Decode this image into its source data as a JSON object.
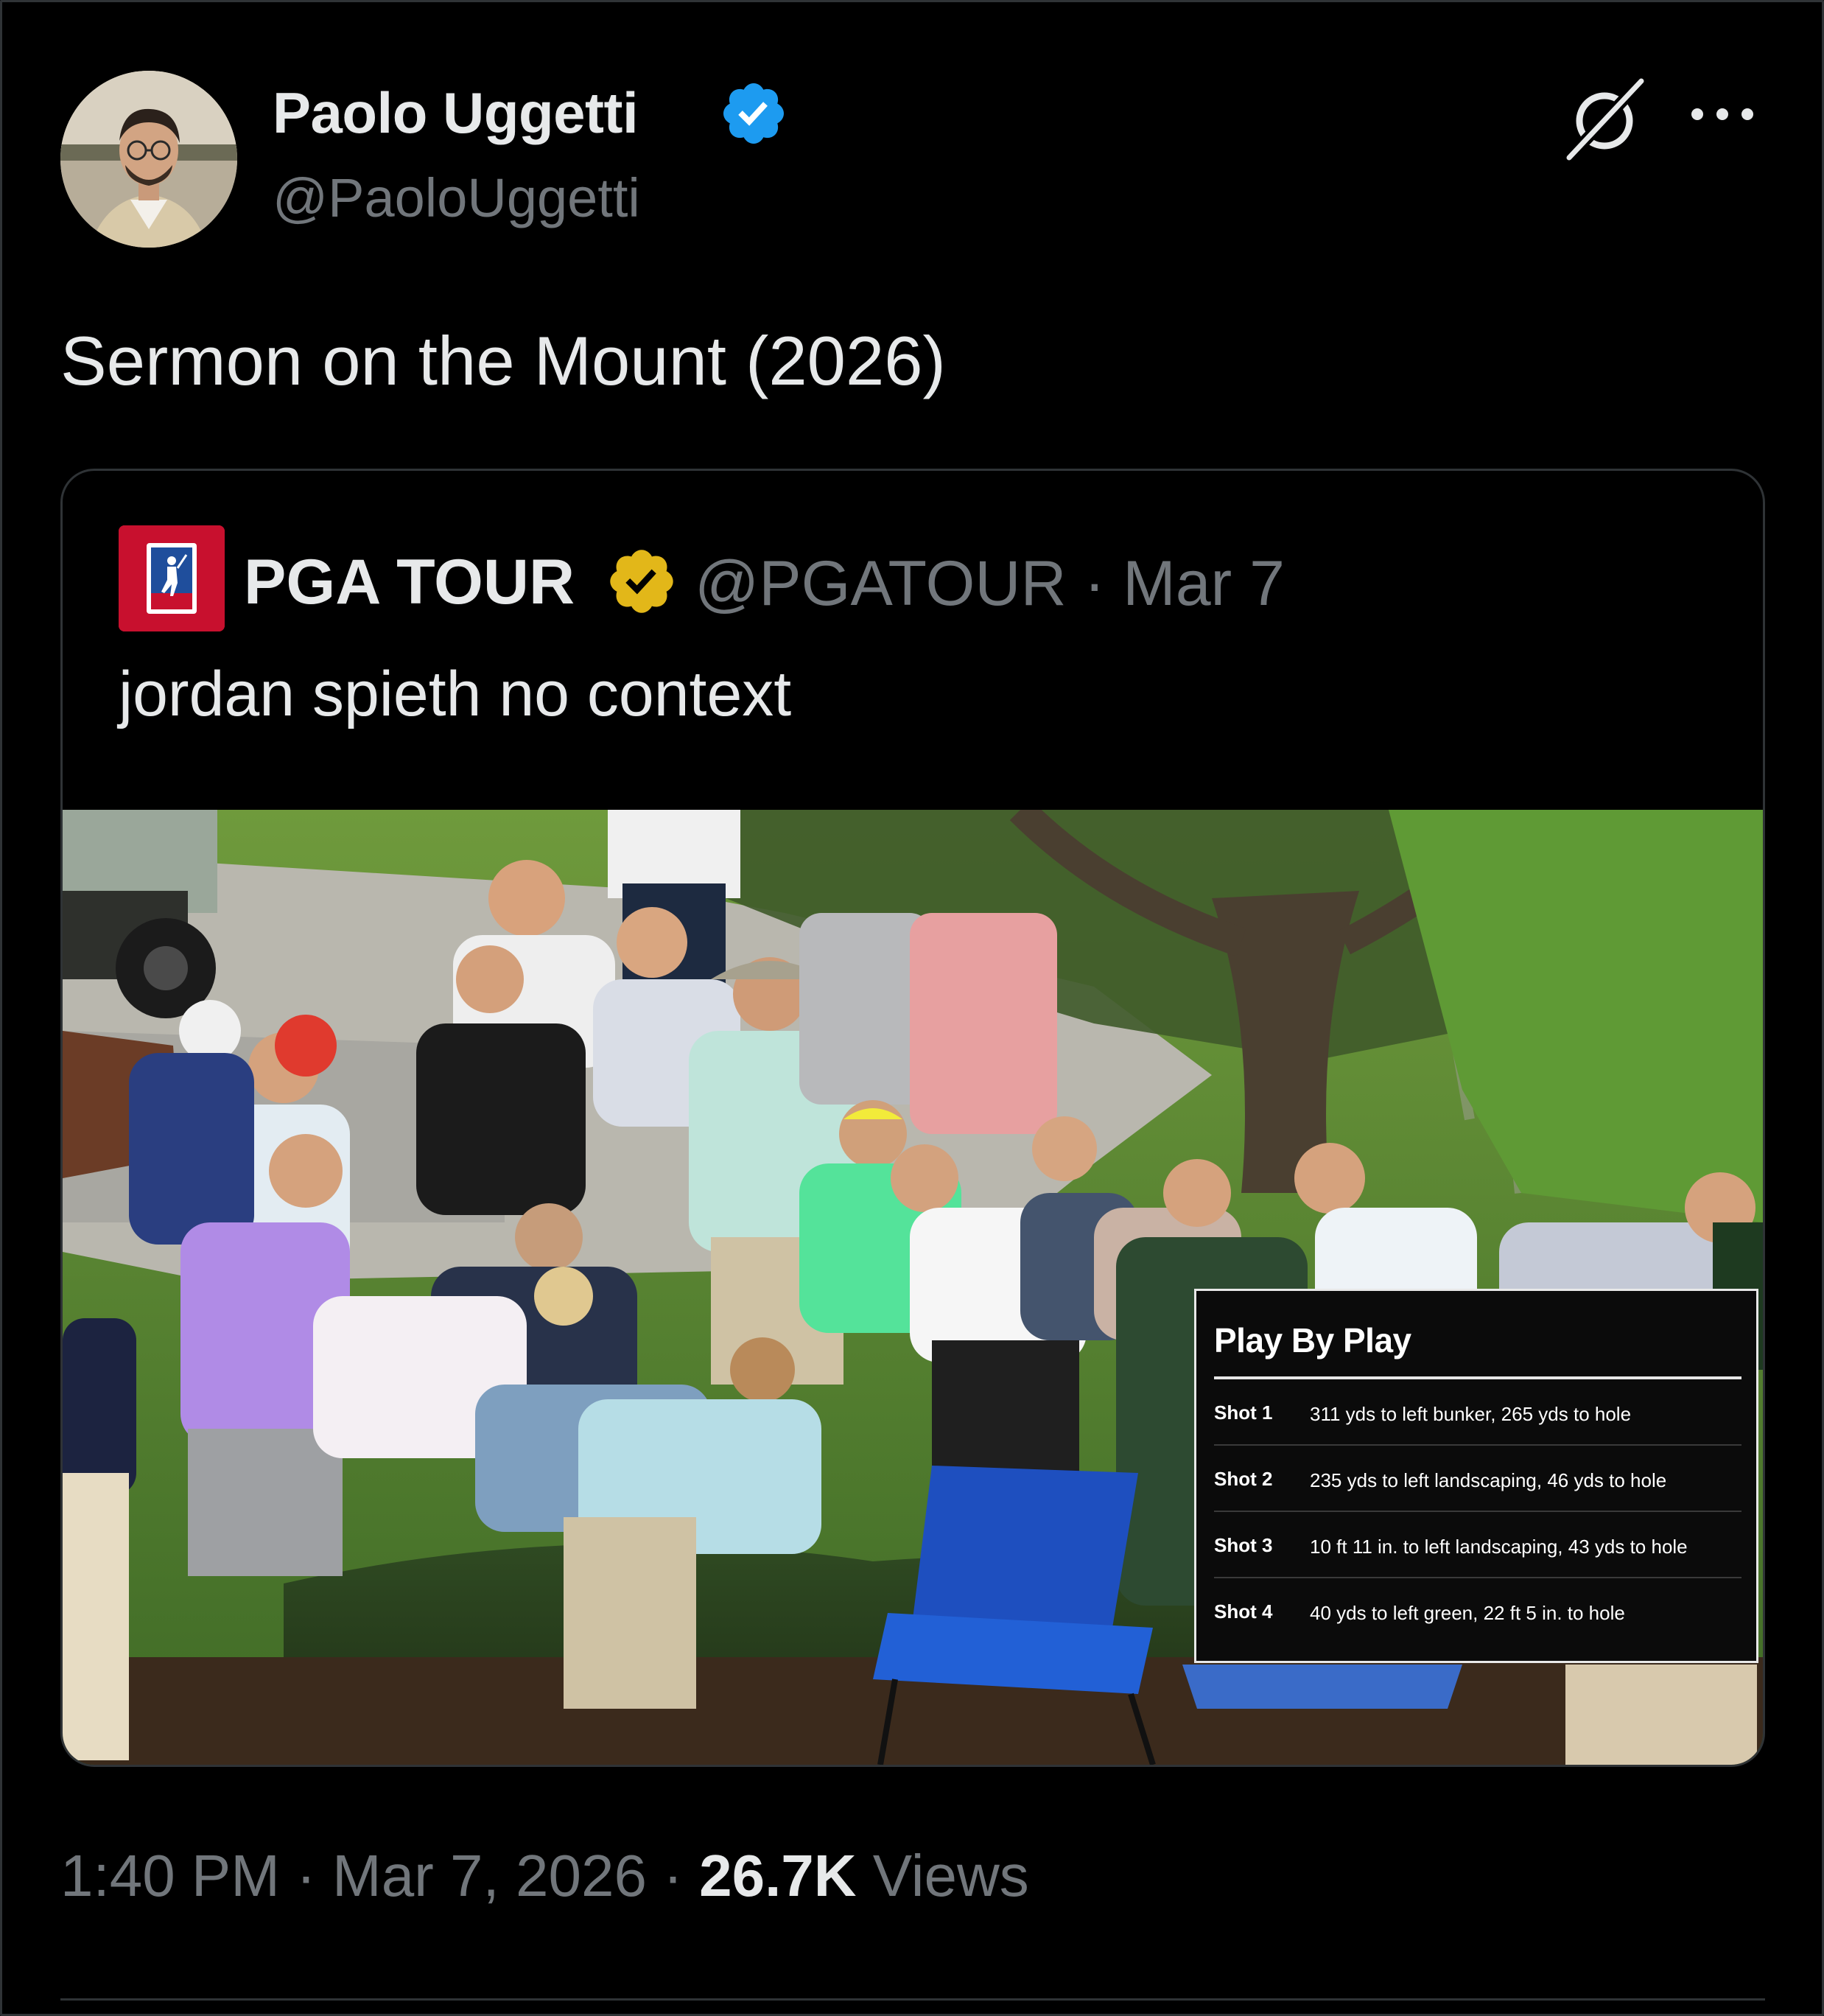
{
  "author": {
    "name": "Paolo Uggetti",
    "handle": "@PaoloUggetti"
  },
  "tweet": {
    "text": "Sermon on the Mount (2026)"
  },
  "quoted_tweet": {
    "name": "PGA TOUR",
    "handle": "@PGATOUR",
    "separator": "·",
    "date": "Mar 7",
    "text": "jordan spieth no context",
    "media": {
      "overlay": {
        "title": "Play By Play",
        "shots": [
          {
            "label": "Shot 1",
            "description": "311 yds to left bunker, 265 yds to hole"
          },
          {
            "label": "Shot 2",
            "description": "235 yds to left landscaping, 46 yds to hole"
          },
          {
            "label": "Shot 3",
            "description": "10 ft 11 in. to left landscaping, 43 yds to hole"
          },
          {
            "label": "Shot 4",
            "description": "40 yds to left green, 22 ft 5 in. to hole"
          }
        ]
      }
    }
  },
  "footer": {
    "time": "1:40 PM",
    "separator": "·",
    "date": "Mar 7, 2026",
    "views_count": "26.7K",
    "views_label": "Views"
  },
  "colors": {
    "background": "#000000",
    "text_primary": "#e7e9ea",
    "text_secondary": "#71767b",
    "border": "#2f3336",
    "verified_blue": "#1d9bf0",
    "verified_gold": "#e2b719",
    "pga_red": "#c8102e"
  },
  "icons": [
    "verified-badge-icon",
    "grok-icon",
    "more-icon",
    "pga-tour-logo",
    "verified-gold-badge-icon"
  ]
}
